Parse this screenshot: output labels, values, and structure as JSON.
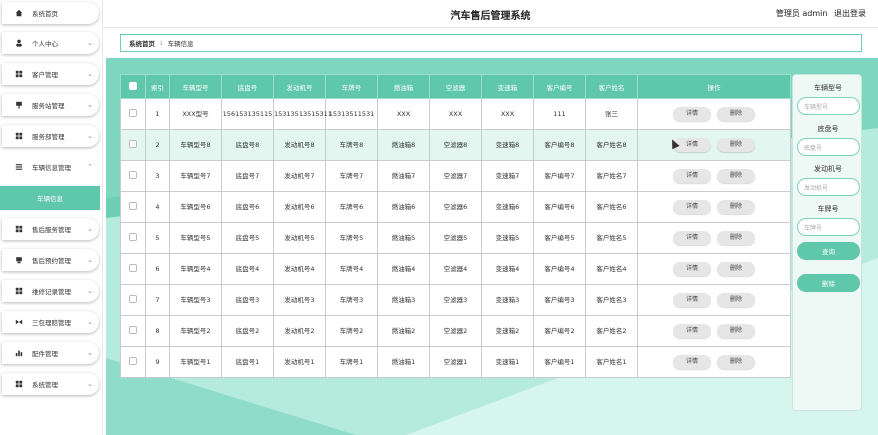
{
  "app": {
    "title": "汽车售后管理系统"
  },
  "header": {
    "admin_label": "管理员 admin",
    "logout_label": "退出登录"
  },
  "sidebar": {
    "items": [
      {
        "label": "系统首页",
        "icon": "home-icon"
      },
      {
        "label": "个人中心",
        "icon": "user-icon"
      },
      {
        "label": "客户管理",
        "icon": "grid-icon"
      },
      {
        "label": "服务站管理",
        "icon": "flag-icon"
      },
      {
        "label": "服务部管理",
        "icon": "grid-icon"
      },
      {
        "label": "车辆信息管理",
        "icon": "list-icon"
      },
      {
        "label": "售后服务管理",
        "icon": "grid-icon"
      },
      {
        "label": "售后预约管理",
        "icon": "bookmark-icon"
      },
      {
        "label": "维修记录管理",
        "icon": "grid-icon"
      },
      {
        "label": "三包理赔管理",
        "icon": "bowtie-icon"
      },
      {
        "label": "配件管理",
        "icon": "bar-chart-icon"
      },
      {
        "label": "系统管理",
        "icon": "grid-icon"
      }
    ],
    "active_sub": "车辆信息"
  },
  "breadcrumb": {
    "home": "系统首页",
    "separator": "፤",
    "current": "车辆信息"
  },
  "table": {
    "headers": [
      "索引",
      "车辆型号",
      "底盘号",
      "发动机号",
      "车牌号",
      "燃油箱",
      "空滤器",
      "变速箱",
      "客户编号",
      "客户姓名",
      "操作"
    ],
    "rows": [
      [
        "1",
        "XXX型号",
        "156153135115",
        "15313513515311",
        "15313511531",
        "XXX",
        "XXX",
        "XXX",
        "111",
        "张三"
      ],
      [
        "2",
        "车辆型号8",
        "底盘号8",
        "发动机号8",
        "车牌号8",
        "燃油箱8",
        "空滤器8",
        "变速箱8",
        "客户编号8",
        "客户姓名8"
      ],
      [
        "3",
        "车辆型号7",
        "底盘号7",
        "发动机号7",
        "车牌号7",
        "燃油箱7",
        "空滤器7",
        "变速箱7",
        "客户编号7",
        "客户姓名7"
      ],
      [
        "4",
        "车辆型号6",
        "底盘号6",
        "发动机号6",
        "车牌号6",
        "燃油箱6",
        "空滤器6",
        "变速箱6",
        "客户编号6",
        "客户姓名6"
      ],
      [
        "5",
        "车辆型号5",
        "底盘号5",
        "发动机号5",
        "车牌号5",
        "燃油箱5",
        "空滤器5",
        "变速箱5",
        "客户编号5",
        "客户姓名5"
      ],
      [
        "6",
        "车辆型号4",
        "底盘号4",
        "发动机号4",
        "车牌号4",
        "燃油箱4",
        "空滤器4",
        "变速箱4",
        "客户编号4",
        "客户姓名4"
      ],
      [
        "7",
        "车辆型号3",
        "底盘号3",
        "发动机号3",
        "车牌号3",
        "燃油箱3",
        "空滤器3",
        "变速箱3",
        "客户编号3",
        "客户姓名3"
      ],
      [
        "8",
        "车辆型号2",
        "底盘号2",
        "发动机号2",
        "车牌号2",
        "燃油箱2",
        "空滤器2",
        "变速箱2",
        "客户编号2",
        "客户姓名2"
      ],
      [
        "9",
        "车辆型号1",
        "底盘号1",
        "发动机号1",
        "车牌号1",
        "燃油箱1",
        "空滤器1",
        "变速箱1",
        "客户编号1",
        "客户姓名1"
      ]
    ],
    "highlighted_row": 1,
    "detail_label": "详情",
    "delete_label": "删除"
  },
  "search": {
    "fields": [
      {
        "label": "车辆型号",
        "placeholder": "车辆型号"
      },
      {
        "label": "底盘号",
        "placeholder": "底盘号"
      },
      {
        "label": "发动机号",
        "placeholder": "发动机号"
      },
      {
        "label": "车牌号",
        "placeholder": "车牌号"
      }
    ],
    "search_label": "查询",
    "delete_label": "删除"
  },
  "colors": {
    "accent": "#5fc7aa",
    "accent_light": "#e3f6f0"
  }
}
